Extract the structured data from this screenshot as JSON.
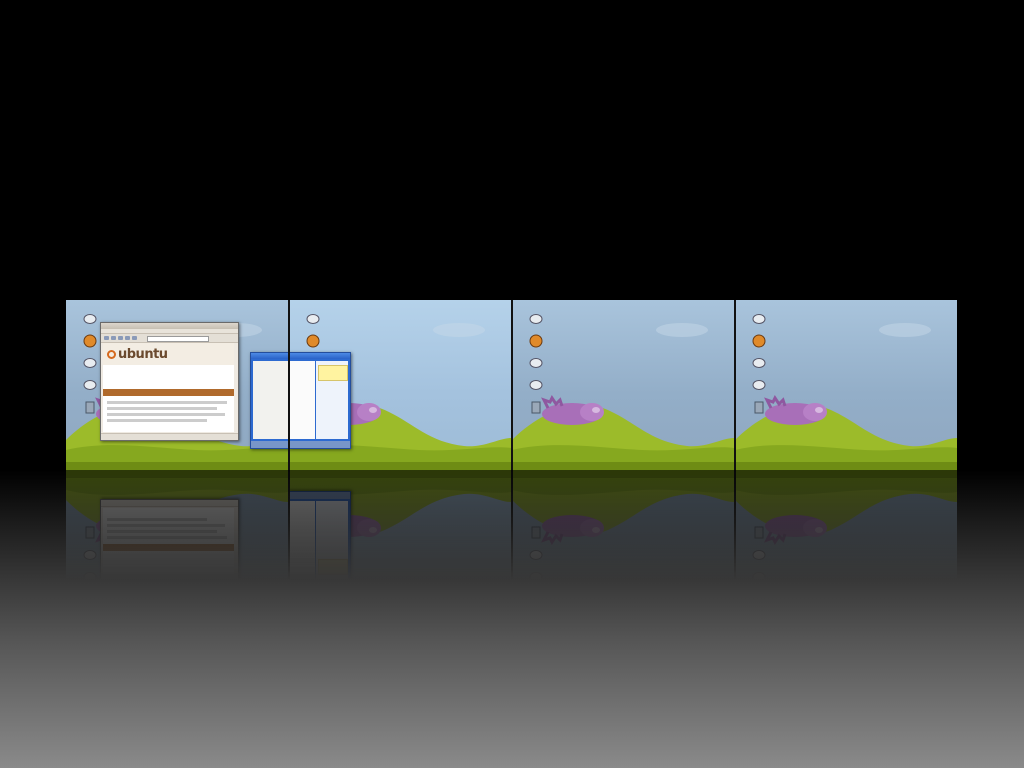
{
  "desktop_cube": {
    "workspaces": [
      {
        "id": "workspace-1",
        "active": false,
        "has_browser": true
      },
      {
        "id": "workspace-2",
        "active": true,
        "has_terminal": true
      },
      {
        "id": "workspace-3",
        "active": false
      },
      {
        "id": "workspace-4",
        "active": false
      }
    ],
    "desktop_icons": [
      "computer-icon",
      "home-folder-icon",
      "network-icon",
      "network-icon-2",
      "trash-icon"
    ],
    "browser": {
      "logo": "ubuntu"
    }
  }
}
